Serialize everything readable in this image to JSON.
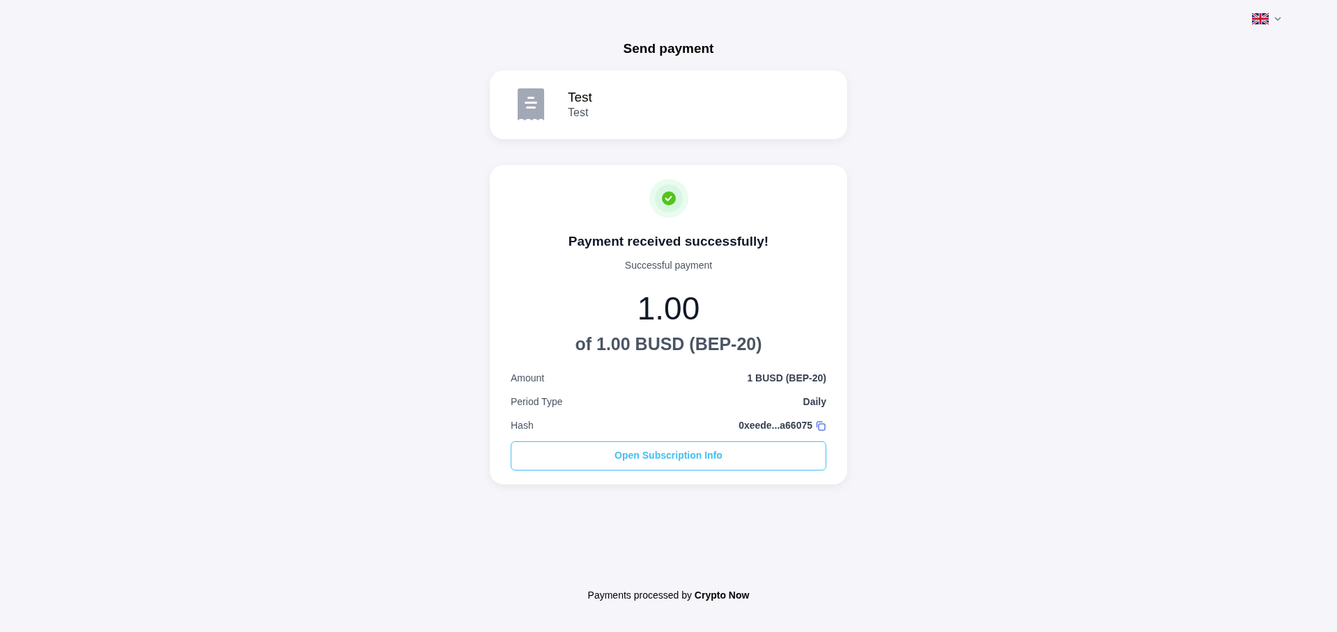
{
  "page_title": "Send payment",
  "merchant": {
    "name": "Test",
    "description": "Test"
  },
  "status": {
    "title": "Payment received successfully!",
    "subtitle": "Successful payment",
    "amount_paid": "1.00",
    "amount_total": "of 1.00 BUSD (BEP-20)"
  },
  "details": [
    {
      "label": "Amount",
      "value": "1 BUSD (BEP-20)",
      "copyable": false
    },
    {
      "label": "Period Type",
      "value": "Daily",
      "copyable": false
    },
    {
      "label": "Hash",
      "value": "0xeede...a66075",
      "copyable": true
    }
  ],
  "action_button": "Open Subscription Info",
  "footer": "Payments processed by **Crypto Now**"
}
